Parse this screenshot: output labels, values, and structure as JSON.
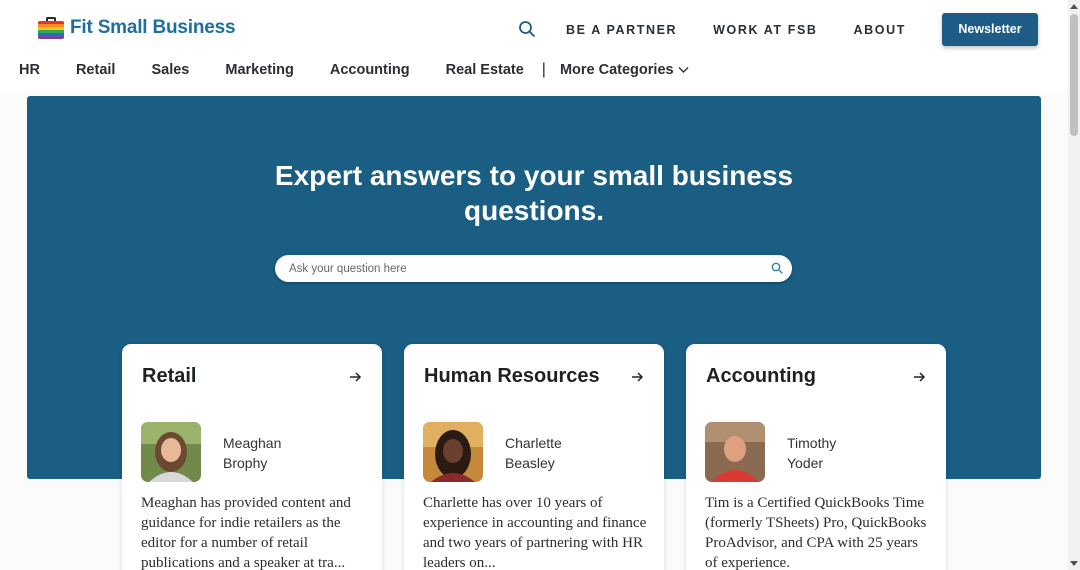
{
  "brand": {
    "name": "Fit Small Business",
    "logo_stripes": [
      "#e5322d",
      "#f58b1f",
      "#f7c51e",
      "#34a853",
      "#1e73be",
      "#7b3fa0"
    ]
  },
  "header": {
    "search_icon": "search-icon",
    "links": [
      "BE A PARTNER",
      "WORK AT FSB",
      "ABOUT"
    ],
    "newsletter_label": "Newsletter"
  },
  "nav": {
    "items": [
      "HR",
      "Retail",
      "Sales",
      "Marketing",
      "Accounting",
      "Real Estate"
    ],
    "separator": "|",
    "more_label": "More Categories",
    "more_icon": "chevron-down-icon"
  },
  "hero": {
    "title": "Expert answers to your small business questions.",
    "search_placeholder": "Ask your question here",
    "search_value": "",
    "background": "#1a5e84"
  },
  "cards": [
    {
      "title": "Retail",
      "author_first": "Meaghan",
      "author_last": "Brophy",
      "description": "Meaghan has provided content and guidance for indie retailers as the editor for a number of retail publications and a speaker at tra..."
    },
    {
      "title": "Human Resources",
      "author_first": "Charlette",
      "author_last": "Beasley",
      "description": "Charlette has over 10 years of experience in accounting and finance and two years of partnering with HR leaders on..."
    },
    {
      "title": "Accounting",
      "author_first": "Timothy",
      "author_last": "Yoder",
      "description": "Tim is a Certified QuickBooks Time (formerly TSheets) Pro, QuickBooks ProAdvisor, and CPA with 25 years of experience."
    }
  ],
  "colors": {
    "accent": "#1c5c86",
    "brand_text": "#1e6fa0"
  }
}
